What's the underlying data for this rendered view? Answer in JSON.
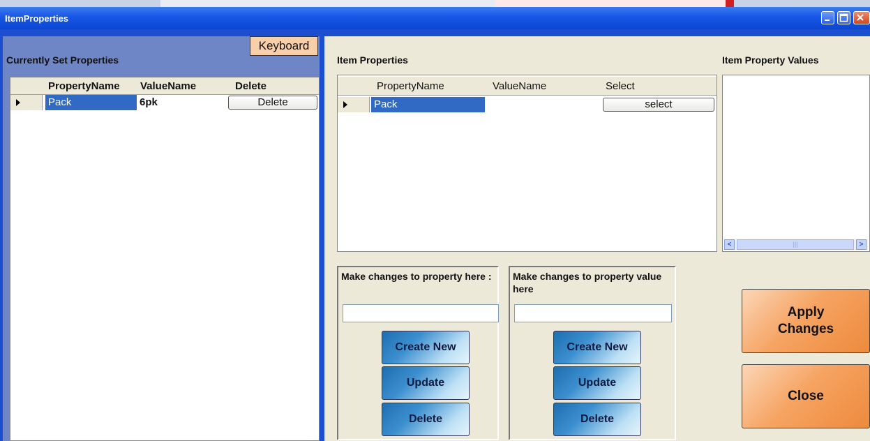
{
  "window": {
    "title": "ItemProperties"
  },
  "left": {
    "title": "Currently Set Properties",
    "keyboard_label": "Keyboard",
    "columns": [
      "PropertyName",
      "ValueName",
      "Delete"
    ],
    "row": {
      "property": "Pack",
      "value": "6pk",
      "button": "Delete"
    }
  },
  "right": {
    "item_properties_label": "Item Properties",
    "values_label": "Item Property Values",
    "columns": [
      "PropertyName",
      "ValueName",
      "Select"
    ],
    "row": {
      "property": "Pack",
      "value": "",
      "button": "select"
    },
    "property_box": {
      "label": "Make changes to property here :",
      "input_value": "",
      "buttons": [
        "Create New",
        "Update",
        "Delete"
      ]
    },
    "value_box": {
      "label": "Make changes to property value here",
      "input_value": "",
      "buttons": [
        "Create New",
        "Update",
        "Delete"
      ]
    },
    "apply_label": "Apply Changes",
    "close_label": "Close"
  },
  "colors": {
    "title_bar": "#1756e6",
    "left_panel": "#6f86c6",
    "selected_row": "#316ac5",
    "keyboard_button": "#f9cfaa",
    "orange_button": "#ed8a3c"
  },
  "icons": {
    "minimize": "minimize-icon",
    "maximize": "maximize-icon",
    "close": "close-icon",
    "row_indicator": "row-pointer-icon"
  }
}
